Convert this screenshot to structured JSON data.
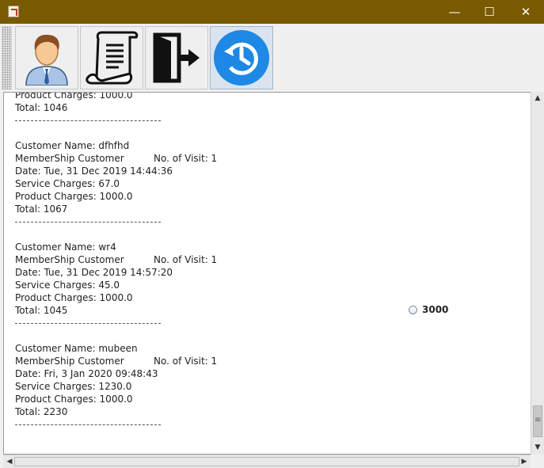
{
  "window": {
    "minimize": "—",
    "maximize": "☐",
    "close": "✕"
  },
  "toolbar": {
    "buttons": [
      "customer-icon",
      "receipt-icon",
      "exit-icon",
      "history-icon"
    ]
  },
  "records": [
    {
      "product": "Product Charges: 1000.0",
      "total": "Total: 1046",
      "separator": "---------------------------------------------"
    },
    {
      "name": "Customer Name: dfhfhd",
      "membership": "MemberShip Customer",
      "visits": "No. of Visit: 1",
      "date": "Date: Tue, 31 Dec 2019 14:44:36",
      "service": "Service Charges: 67.0",
      "product": "Product Charges: 1000.0",
      "total": "Total: 1067",
      "separator": "---------------------------------------------"
    },
    {
      "name": "Customer Name: wr4",
      "membership": "MemberShip Customer",
      "visits": "No. of Visit: 1",
      "date": "Date: Tue, 31 Dec 2019 14:57:20",
      "service": "Service Charges: 45.0",
      "product": "Product Charges: 1000.0",
      "total": "Total: 1045",
      "separator": "---------------------------------------------"
    },
    {
      "name": "Customer Name: mubeen",
      "membership": "MemberShip Customer",
      "visits": "No. of Visit: 1",
      "date": "Date: Fri, 3 Jan 2020 09:48:43",
      "service": "Service Charges: 1230.0",
      "product": "Product Charges: 1000.0",
      "total": "Total: 2230",
      "separator": "---------------------------------------------"
    }
  ],
  "radio": {
    "label": "3000",
    "checked": false
  }
}
